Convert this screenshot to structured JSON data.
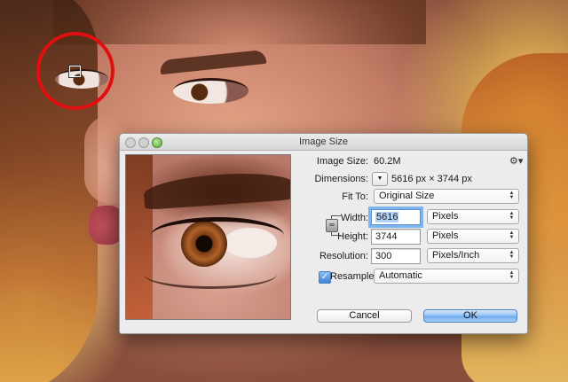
{
  "dialog": {
    "title": "Image Size",
    "image_size_label": "Image Size:",
    "image_size_value": "60.2M",
    "dimensions_label": "Dimensions:",
    "dimensions_value": "5616 px  ×  3744 px",
    "fit_to_label": "Fit To:",
    "fit_to_value": "Original Size",
    "width_label": "Width:",
    "width_value": "5616",
    "width_unit": "Pixels",
    "height_label": "Height:",
    "height_value": "3744",
    "height_unit": "Pixels",
    "resolution_label": "Resolution:",
    "resolution_value": "300",
    "resolution_unit": "Pixels/Inch",
    "resample_label": "Resample:",
    "resample_checked": true,
    "resample_value": "Automatic",
    "cancel_label": "Cancel",
    "ok_label": "OK"
  },
  "icons": {
    "gear": "gear-icon",
    "link": "chain-link-icon",
    "dimensions_menu": "triangle-down-icon",
    "select_arrows": "updown-arrows-icon",
    "checkmark": "checkmark-icon"
  },
  "colors": {
    "highlight_circle": "#e01010",
    "selection": "#b4d3f5",
    "focus_ring": "#7db5ee",
    "ok_button": "#6aa8ec"
  }
}
